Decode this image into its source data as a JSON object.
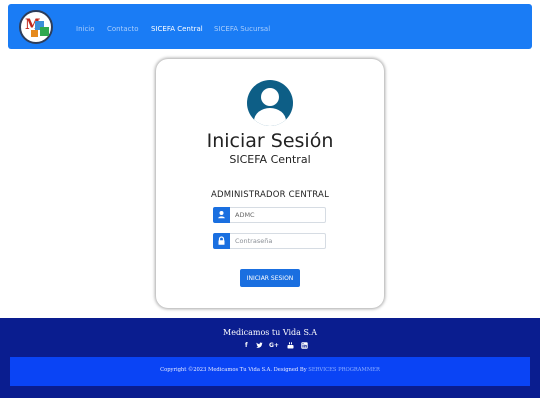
{
  "navbar": {
    "links": [
      {
        "label": "Inicio",
        "active": false
      },
      {
        "label": "Contacto",
        "active": false
      },
      {
        "label": "SICEFA Central",
        "active": true
      },
      {
        "label": "SICEFA Sucursal",
        "active": false
      }
    ],
    "logo_icon": "medical-cross-logo"
  },
  "login": {
    "avatar_icon": "user-circle-icon",
    "title": "Iniciar Sesión",
    "subtitle": "SICEFA Central",
    "section": "ADMINISTRADOR CENTRAL",
    "user_field": {
      "value": "ADMC",
      "icon": "user-icon"
    },
    "password_field": {
      "placeholder": "Contraseña",
      "icon": "lock-icon"
    },
    "submit_label": "INICIAR SESION"
  },
  "footer": {
    "title": "Medicamos tu Vida S.A",
    "socials": [
      "facebook-icon",
      "twitter-icon",
      "google-plus-icon",
      "youtube-icon",
      "linkedin-icon"
    ],
    "copyright_prefix": "Copyright ©2023 Medicamos Tu Vida S.A. Designed By ",
    "designer_link": "SERVICES PROGRAMMER"
  },
  "colors": {
    "navbar": "#1a7cf5",
    "primary_button": "#1a6fe0",
    "avatar": "#0d5e86",
    "footer": "#0a1d8f",
    "copyright_bar": "#0a44f5"
  }
}
